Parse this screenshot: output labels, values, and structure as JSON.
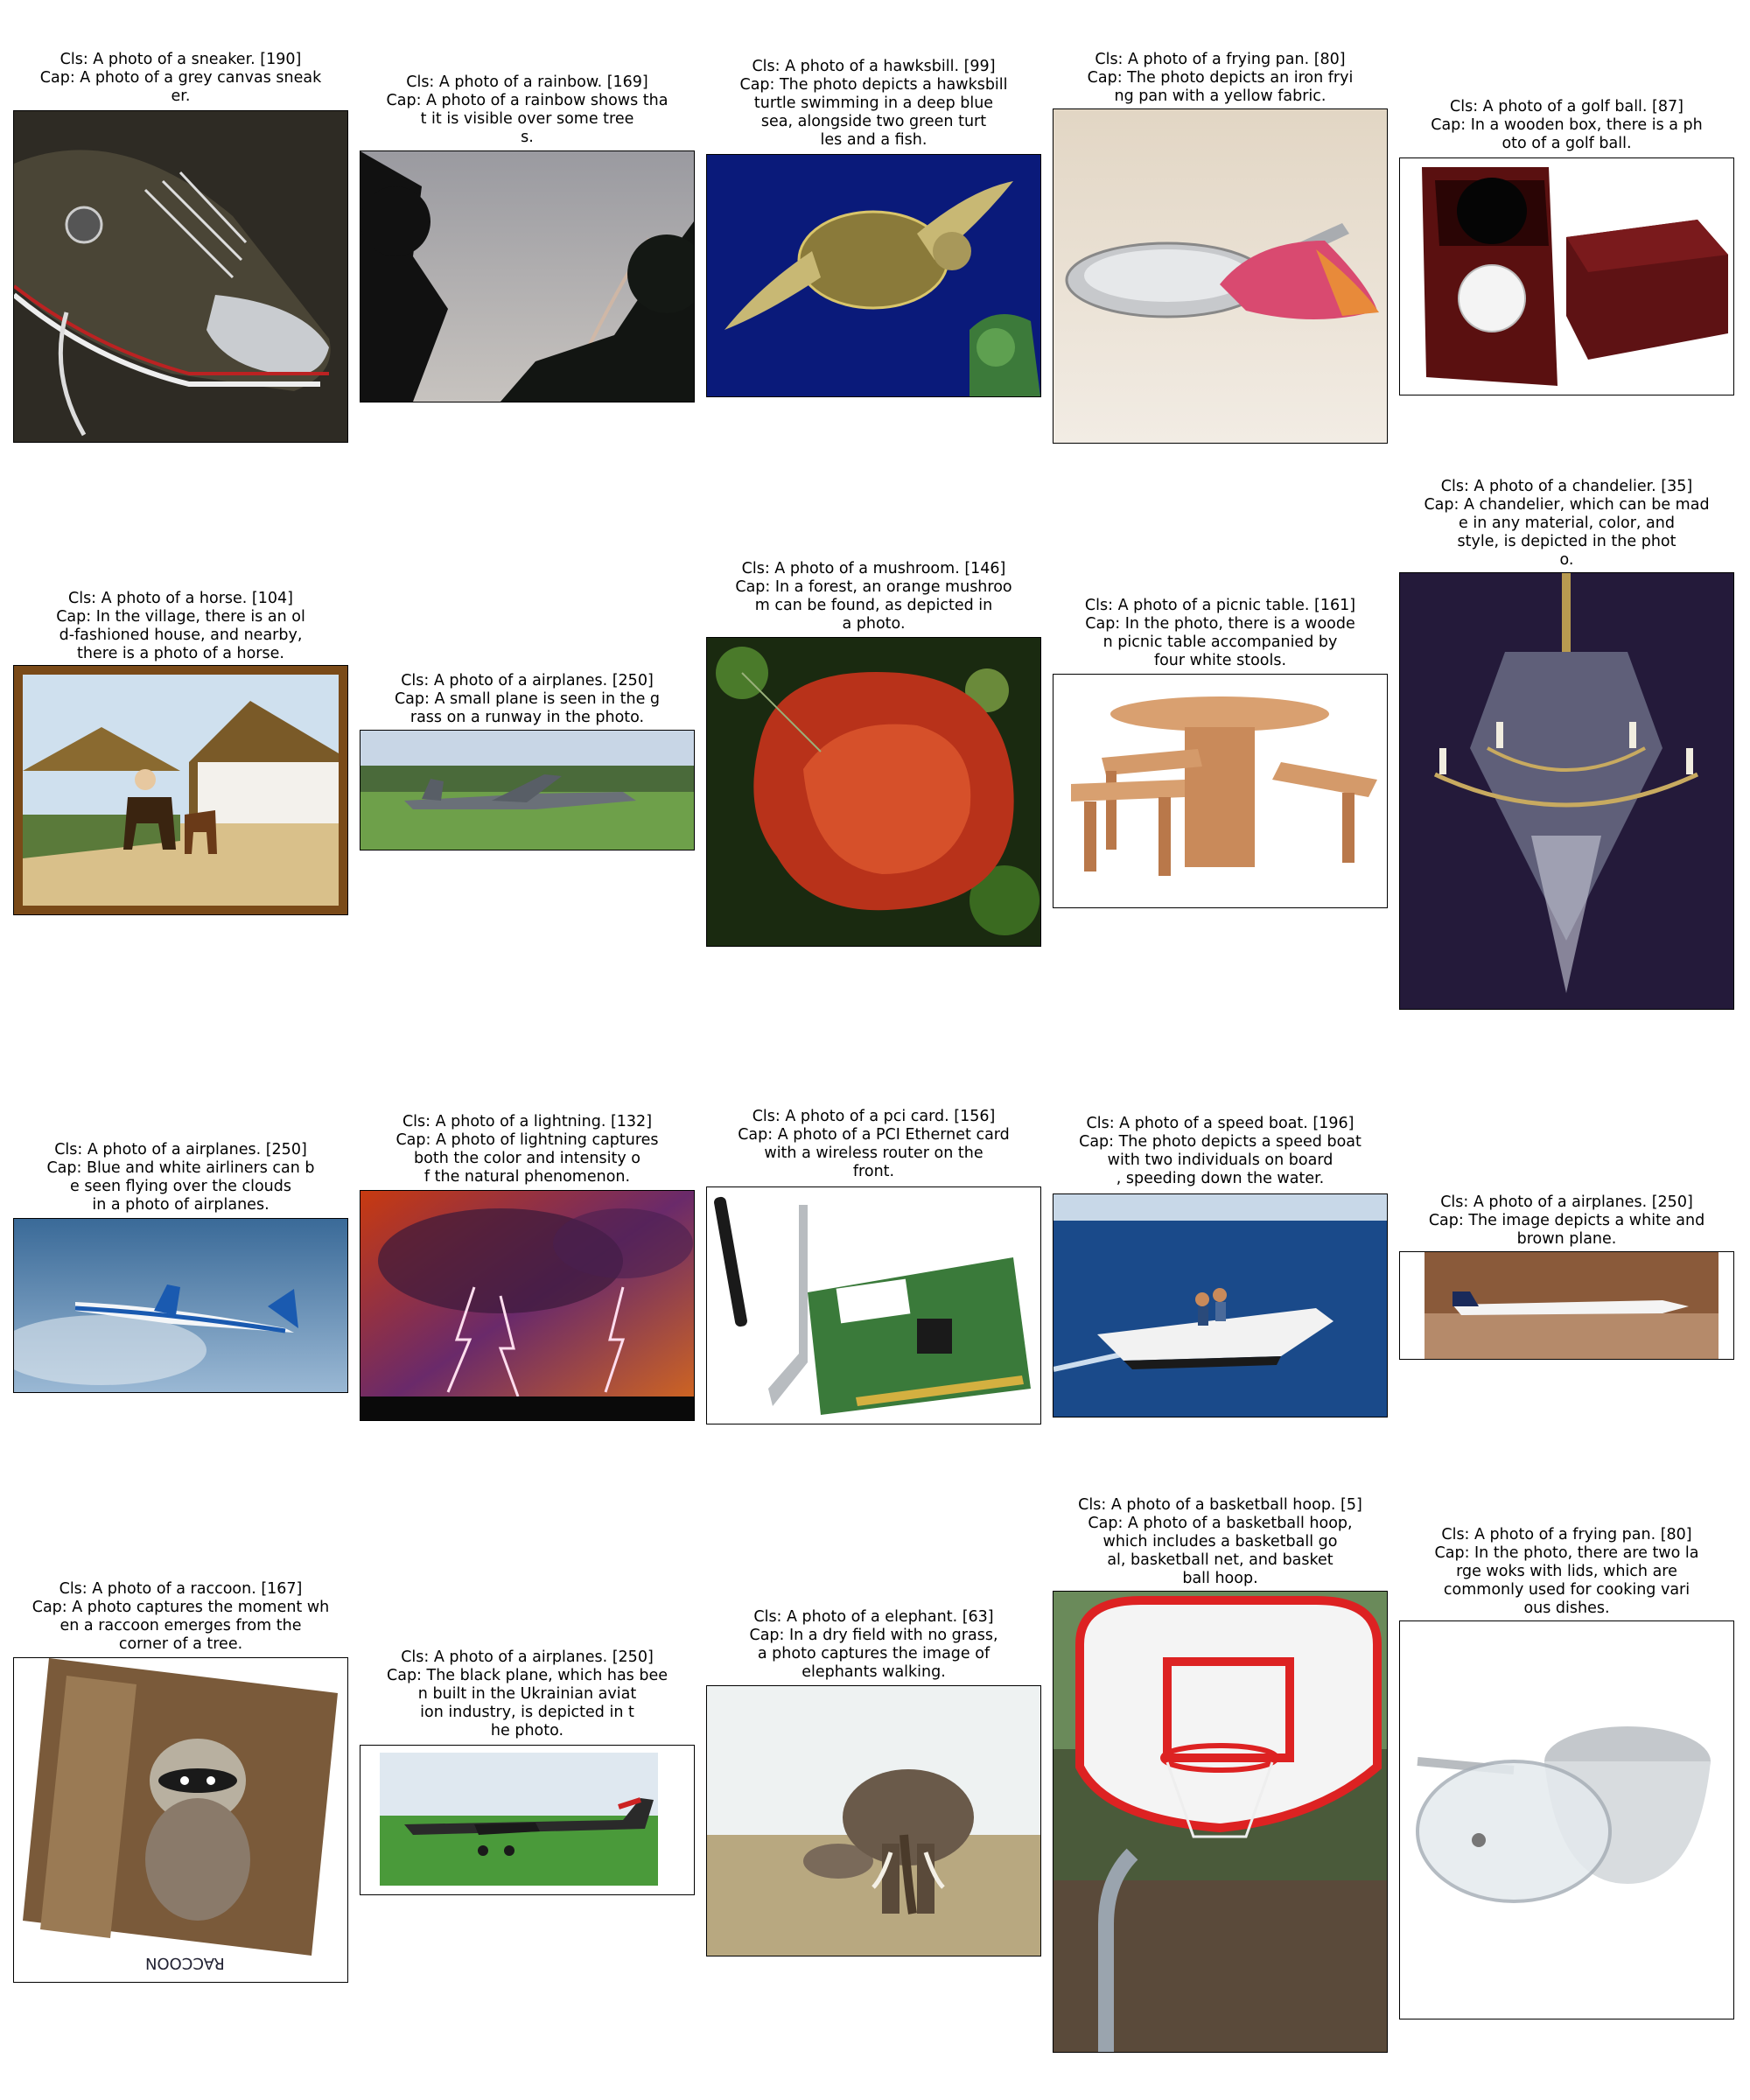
{
  "cells": [
    {
      "cls": "Cls: A photo of a sneaker. [190]",
      "cap": "Cap: A photo of a grey canvas sneak\ner.",
      "icon": "sneaker"
    },
    {
      "cls": "Cls: A photo of a rainbow. [169]",
      "cap": "Cap: A photo of a rainbow shows tha\nt it is visible over some tree\ns.",
      "icon": "rainbow"
    },
    {
      "cls": "Cls: A photo of a hawksbill. [99]",
      "cap": "Cap: The photo depicts a hawksbill\nturtle swimming in a deep blue\nsea, alongside two green turt\nles and a fish.",
      "icon": "turtle"
    },
    {
      "cls": "Cls: A photo of a frying pan. [80]",
      "cap": "Cap: The photo depicts an iron fryi\nng pan with a yellow fabric.",
      "icon": "frying-pan"
    },
    {
      "cls": "Cls: A photo of a golf ball. [87]",
      "cap": "Cap: In a wooden box, there is a ph\noto of a golf ball.",
      "icon": "golf-ball"
    },
    {
      "cls": "Cls: A photo of a horse. [104]",
      "cap": "Cap: In the village, there is an ol\nd-fashioned house, and nearby,\nthere is a photo of a horse.",
      "icon": "horse"
    },
    {
      "cls": "Cls: A photo of a airplanes. [250]",
      "cap": "Cap: A small plane is seen in the g\nrass on a runway in the photo.",
      "icon": "airplane"
    },
    {
      "cls": "Cls: A photo of a mushroom. [146]",
      "cap": "Cap: In a forest, an orange mushroo\nm can be found, as depicted in\na photo.",
      "icon": "mushroom"
    },
    {
      "cls": "Cls: A photo of a picnic table. [161]",
      "cap": "Cap: In the photo, there is a woode\nn picnic table accompanied by\nfour white stools.",
      "icon": "picnic-table"
    },
    {
      "cls": "Cls: A photo of a chandelier. [35]",
      "cap": "Cap: A chandelier, which can be mad\ne in any material, color, and\nstyle, is depicted in the phot\no.",
      "icon": "chandelier"
    },
    {
      "cls": "Cls: A photo of a airplanes. [250]",
      "cap": "Cap: Blue and white airliners can b\ne seen flying over the clouds\nin a photo of airplanes.",
      "icon": "airliner"
    },
    {
      "cls": "Cls: A photo of a lightning. [132]",
      "cap": "Cap: A photo of lightning captures\nboth the color and intensity o\nf the natural phenomenon.",
      "icon": "lightning"
    },
    {
      "cls": "Cls: A photo of a pci card. [156]",
      "cap": "Cap: A photo of a PCI Ethernet card\nwith a wireless router on the\nfront.",
      "icon": "pci-card"
    },
    {
      "cls": "Cls: A photo of a speed boat. [196]",
      "cap": "Cap: The photo depicts a speed boat\nwith two individuals on board\n, speeding down the water.",
      "icon": "speed-boat"
    },
    {
      "cls": "Cls: A photo of a airplanes. [250]",
      "cap": "Cap: The image depicts a white and\nbrown plane.",
      "icon": "jet"
    },
    {
      "cls": "Cls: A photo of a raccoon. [167]",
      "cap": "Cap: A photo captures the moment wh\nen a raccoon emerges from the\ncorner of a tree.",
      "icon": "raccoon",
      "photo_text": "RACCOON"
    },
    {
      "cls": "Cls: A photo of a airplanes. [250]",
      "cap": "Cap: The black plane, which has bee\nn built in the Ukrainian aviat\nion industry, is depicted in t\nhe photo.",
      "icon": "prop-plane"
    },
    {
      "cls": "Cls: A photo of a elephant. [63]",
      "cap": "Cap: In a dry field with no grass,\na photo captures the image of\nelephants walking.",
      "icon": "elephant"
    },
    {
      "cls": "Cls: A photo of a basketball hoop. [5]",
      "cap": "Cap: A photo of a basketball hoop,\nwhich includes a basketball go\nal, basketball net, and basket\nball hoop.",
      "icon": "basketball-hoop"
    },
    {
      "cls": "Cls: A photo of a frying pan. [80]",
      "cap": "Cap: In the photo, there are two la\nrge woks with lids, which are\ncommonly used for cooking vari\nous dishes.",
      "icon": "wok"
    }
  ]
}
